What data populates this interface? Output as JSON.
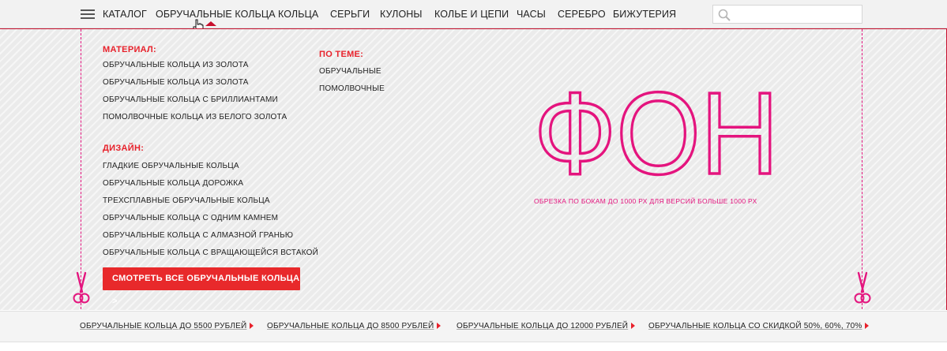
{
  "nav": {
    "catalog_label": "КАТАЛОГ",
    "items": [
      {
        "label": "ОБРУЧАЛЬНЫЕ КОЛЬЦА"
      },
      {
        "label": "КОЛЬЦА"
      },
      {
        "label": "СЕРЬГИ"
      },
      {
        "label": "КУЛОНЫ"
      },
      {
        "label": "КОЛЬЕ И ЦЕПИ"
      },
      {
        "label": "ЧАСЫ"
      },
      {
        "label": "СЕРЕБРО"
      },
      {
        "label": "БИЖУТЕРИЯ"
      }
    ],
    "active_item": "ОБРУЧАЛЬНЫЕ КОЛЬЦА",
    "search": {
      "value": "",
      "placeholder": ""
    }
  },
  "dropdown": {
    "material": {
      "title": "МАТЕРИАЛ:",
      "links": [
        "ОБРУЧАЛЬНЫЕ КОЛЬЦА ИЗ ЗОЛОТА",
        "ОБРУЧАЛЬНЫЕ КОЛЬЦА ИЗ ЗОЛОТА",
        "ОБРУЧАЛЬНЫЕ КОЛЬЦА С БРИЛЛИАНТАМИ",
        "ПОМОЛВОЧНЫЕ КОЛЬЦА ИЗ БЕЛОГО ЗОЛОТА"
      ]
    },
    "design": {
      "title": "ДИЗАЙН:",
      "links": [
        "ГЛАДКИЕ ОБРУЧАЛЬНЫЕ КОЛЬЦА",
        "ОБРУЧАЛЬНЫЕ КОЛЬЦА ДОРОЖКА",
        "ТРЕХСПЛАВНЫЕ ОБРУЧАЛЬНЫЕ КОЛЬЦА",
        "ОБРУЧАЛЬНЫЕ КОЛЬЦА С ОДНИМ КАМНЕМ",
        "ОБРУЧАЛЬНЫЕ КОЛЬЦА С АЛМАЗНОЙ ГРАНЬЮ",
        "ОБРУЧАЛЬНЫЕ КОЛЬЦА С ВРАЩАЮЩЕЙСЯ ВСТАКОЙ"
      ]
    },
    "theme": {
      "title": "ПО ТЕМЕ:",
      "links": [
        "ОБРУЧАЛЬНЫЕ",
        "ПОМОЛВОЧНЫЕ"
      ]
    },
    "cta_label": "СМОТРЕТЬ ВСЕ ОБРУЧАЛЬНЫЕ КОЛЬЦА >",
    "background_title": "ФОН",
    "background_note": "ОБРЕЗКА ПО БОКАМ ДО 1000 РХ ДЛЯ ВЕРСИЙ БОЛЬШЕ 1000 РХ"
  },
  "bottom_links": [
    "ОБРУЧАЛЬНЫЕ КОЛЬЦА ДО 5500 РУБЛЕЙ",
    "ОБРУЧАЛЬНЫЕ КОЛЬЦА ДО 8500 РУБЛЕЙ",
    "ОБРУЧАЛЬНЫЕ КОЛЬЦА ДО 12000 РУБЛЕЙ",
    "ОБРУЧАЛЬНЫЕ КОЛЬЦА СО СКИДКОЙ 50%, 60%, 70%"
  ],
  "colors": {
    "accent_red": "#e8212b",
    "guide_magenta": "#e4147e",
    "nav_active_caret": "#c8102e",
    "panel_bg": "#ebebeb"
  },
  "icons": {
    "menu": "hamburger-menu-icon",
    "search": "search-icon",
    "cursor": "hand-pointer-icon",
    "scissors": "scissors-icon",
    "arrow": "triangle-right-icon"
  }
}
